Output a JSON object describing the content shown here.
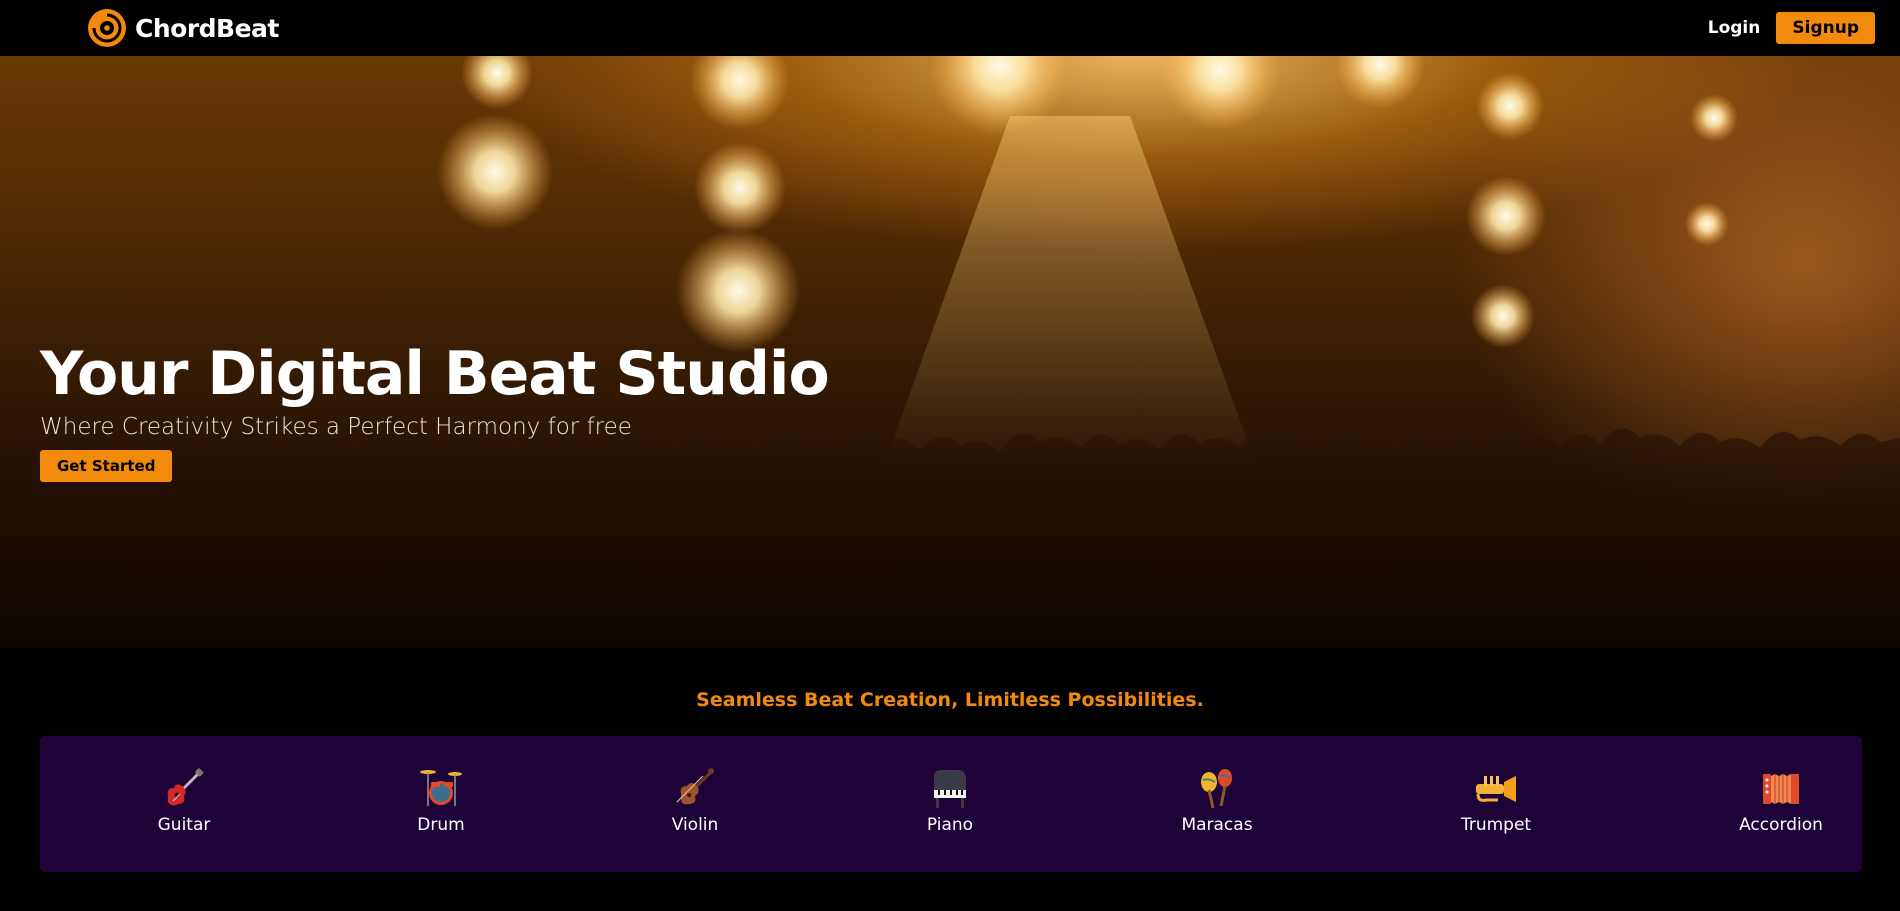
{
  "brand": {
    "name": "ChordBeat",
    "accent": "#f28a0c",
    "panel": "#1e0338"
  },
  "nav": {
    "login_label": "Login",
    "signup_label": "Signup"
  },
  "hero": {
    "title": "Your Digital Beat Studio",
    "subtitle": "Where Creativity Strikes a Perfect Harmony for free",
    "cta_label": "Get Started"
  },
  "features": {
    "tagline": "Seamless Beat Creation, Limitless Possibilities.",
    "instruments": [
      {
        "label": "Guitar",
        "icon": "guitar-icon"
      },
      {
        "label": "Drum",
        "icon": "drum-icon"
      },
      {
        "label": "Violin",
        "icon": "violin-icon"
      },
      {
        "label": "Piano",
        "icon": "piano-icon"
      },
      {
        "label": "Maracas",
        "icon": "maracas-icon"
      },
      {
        "label": "Trumpet",
        "icon": "trumpet-icon"
      },
      {
        "label": "Accordion",
        "icon": "accordion-icon"
      }
    ]
  }
}
